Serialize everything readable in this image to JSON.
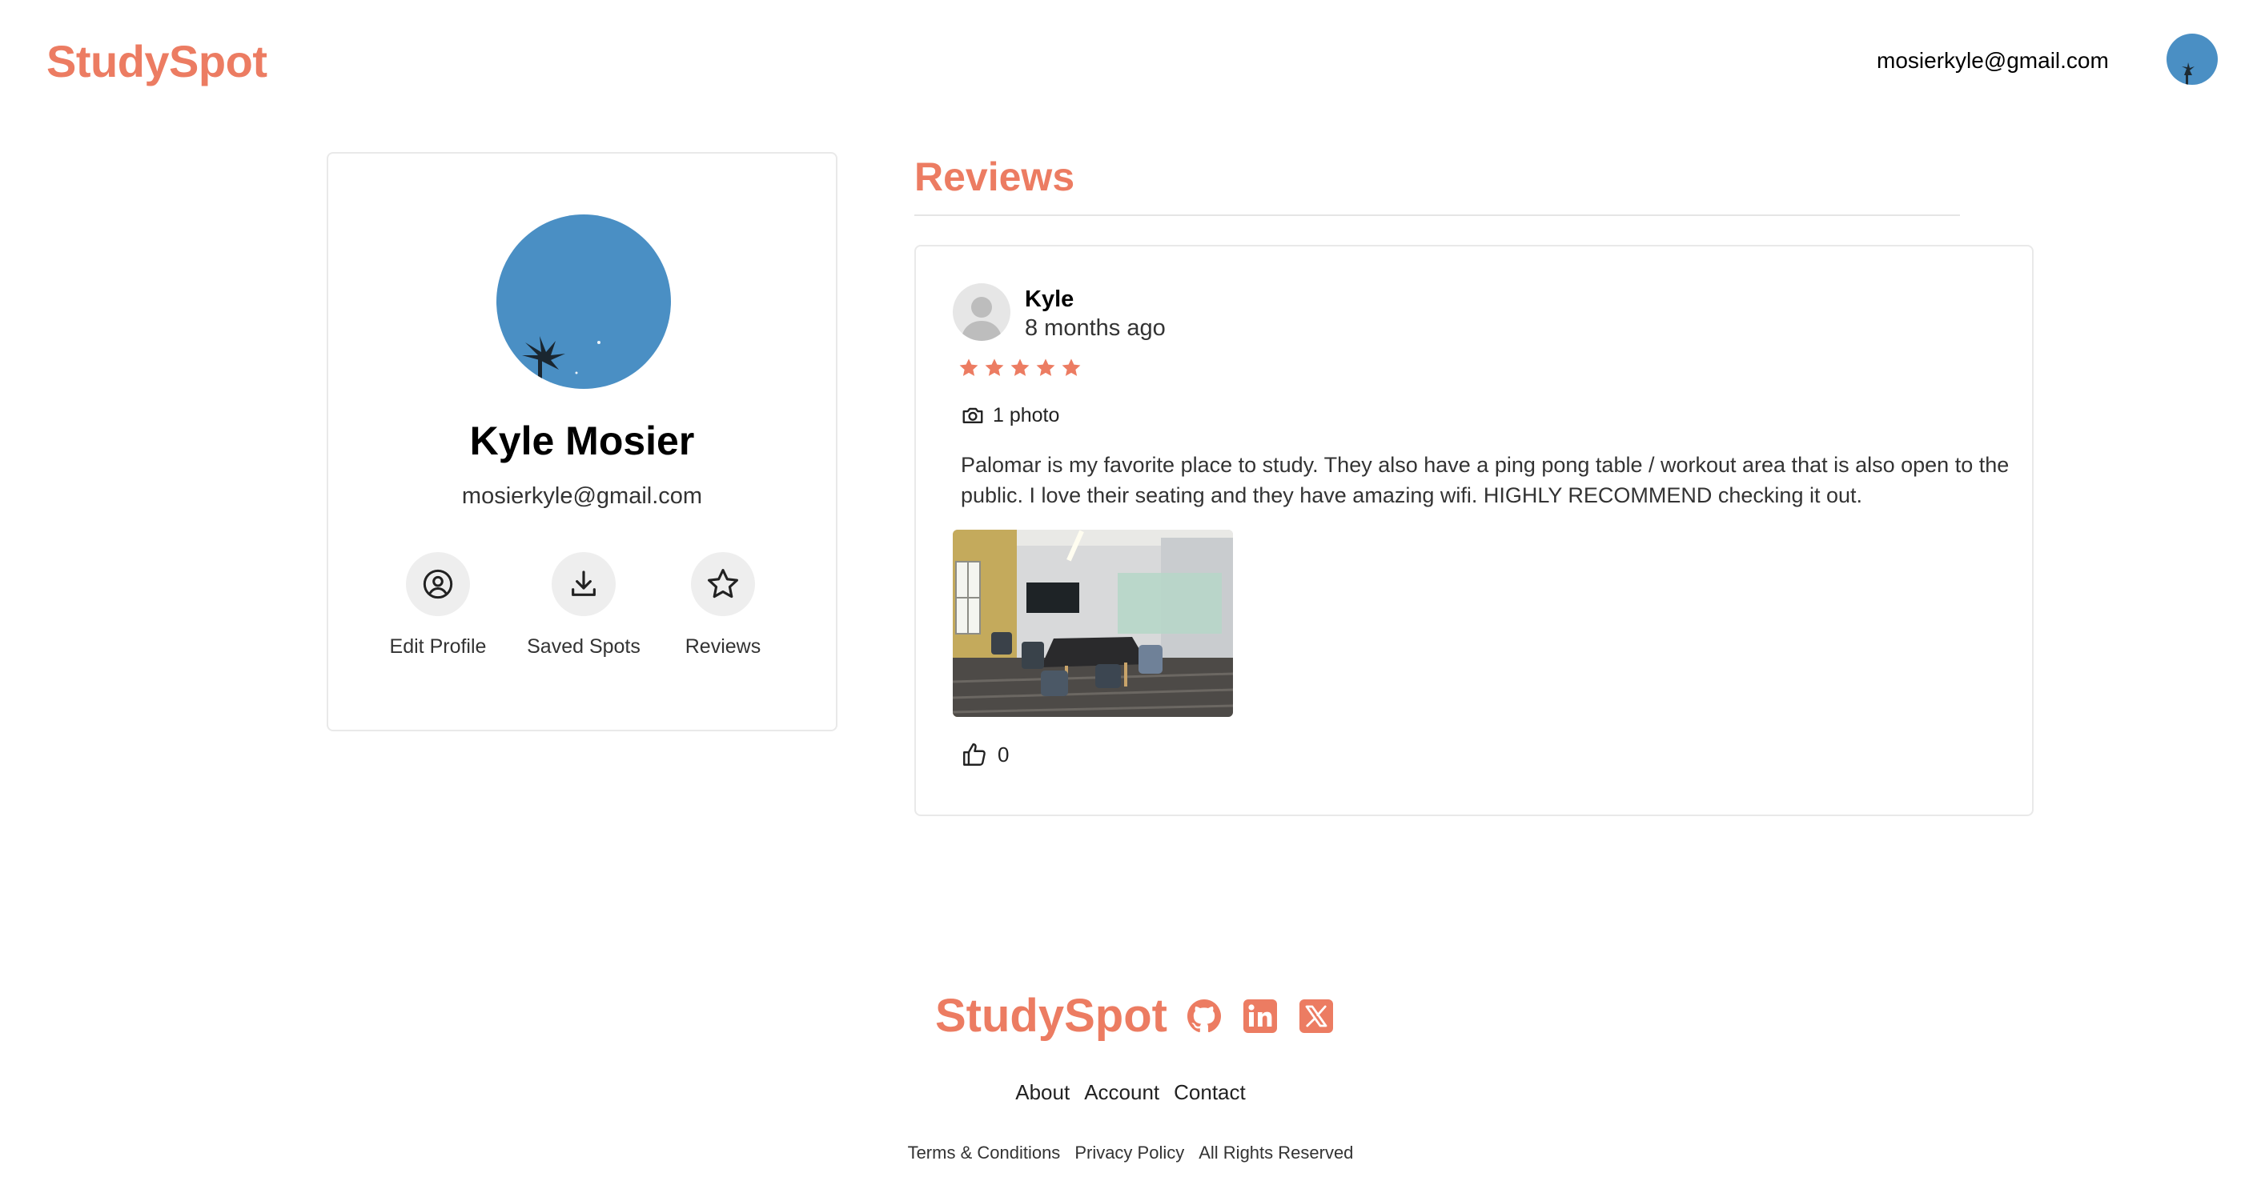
{
  "header": {
    "logo": "StudySpot",
    "user_email": "mosierkyle@gmail.com"
  },
  "profile": {
    "name": "Kyle Mosier",
    "email": "mosierkyle@gmail.com",
    "actions": [
      {
        "label": "Edit Profile",
        "icon": "user-circle-icon"
      },
      {
        "label": "Saved Spots",
        "icon": "download-icon"
      },
      {
        "label": "Reviews",
        "icon": "star-outline-icon"
      }
    ]
  },
  "reviews": {
    "title": "Reviews",
    "items": [
      {
        "author": "Kyle",
        "time": "8 months ago",
        "rating": 5,
        "photo_count": "1 photo",
        "text": "Palomar is my favorite place to study. They also have a ping pong table / workout area that is also open to the public. I love their seating and they have amazing wifi. HIGHLY RECOMMEND checking it out.",
        "likes": "0"
      }
    ]
  },
  "footer": {
    "logo": "StudySpot",
    "social_icons": [
      "github-icon",
      "linkedin-icon",
      "x-icon"
    ],
    "links": [
      "About",
      "Account",
      "Contact"
    ],
    "legal": [
      "Terms & Conditions",
      "Privacy Policy",
      "All Rights Reserved"
    ]
  },
  "colors": {
    "brand": "#ec7c62",
    "avatar_sky": "#4a8fc4",
    "border": "#e9e9e9"
  }
}
